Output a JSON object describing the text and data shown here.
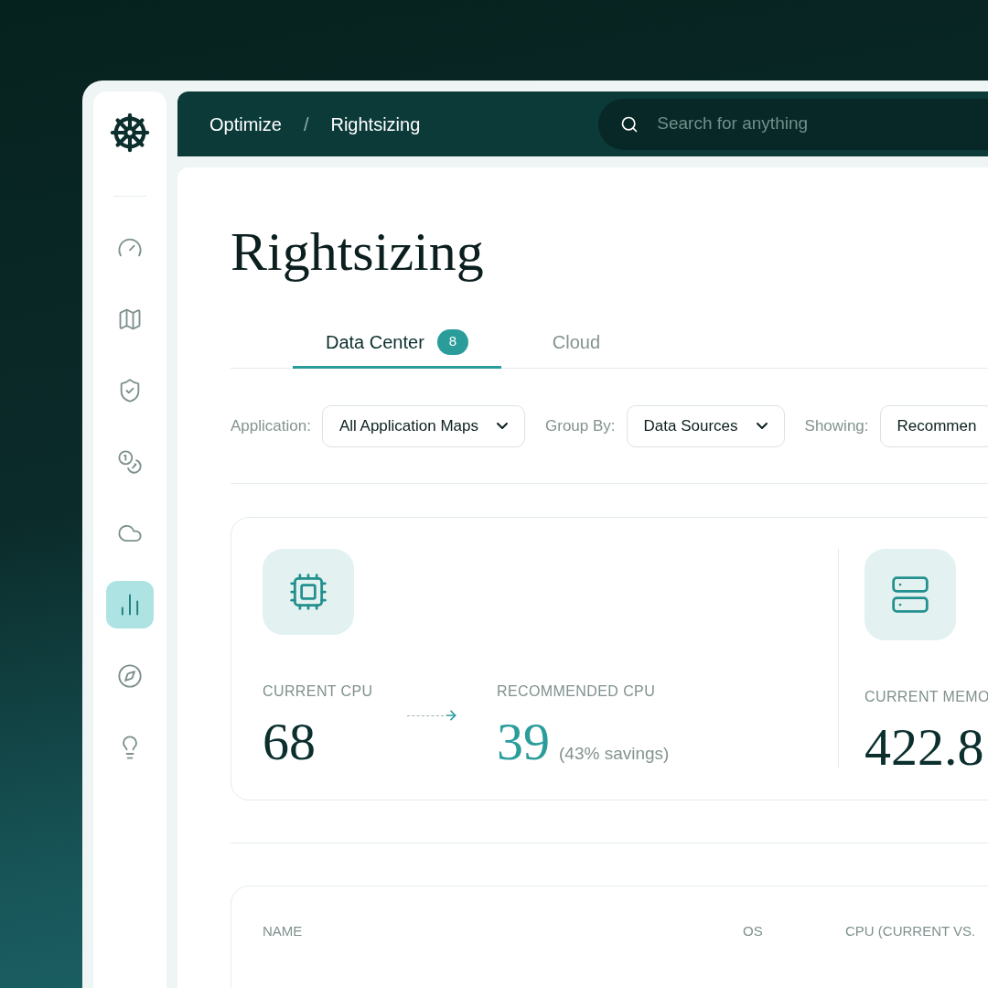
{
  "breadcrumb": [
    "Optimize",
    "Rightsizing"
  ],
  "breadcrumb_separator": "/",
  "search": {
    "placeholder": "Search for anything"
  },
  "sidebar": {
    "items": [
      {
        "selected": false
      },
      {
        "selected": false
      },
      {
        "selected": false
      },
      {
        "selected": false
      },
      {
        "selected": false
      },
      {
        "selected": true
      },
      {
        "selected": false
      },
      {
        "selected": false
      }
    ]
  },
  "page_title": "Rightsizing",
  "tabs": [
    {
      "label": "Data Center",
      "badge": "8",
      "selected": true
    },
    {
      "label": "Cloud",
      "selected": false
    }
  ],
  "filters": [
    {
      "label": "Application:",
      "value": "All Application Maps"
    },
    {
      "label": "Group By:",
      "value": "Data Sources"
    },
    {
      "label": "Showing:",
      "value": "Recommen"
    }
  ],
  "stats": [
    {
      "current_label": "CURRENT CPU",
      "current_value": "68",
      "recommended_label": "RECOMMENDED CPU",
      "recommended_value": "39",
      "savings": "(43% savings)"
    },
    {
      "current_label": "CURRENT MEMO",
      "current_value": "422.8"
    }
  ],
  "table": {
    "columns": [
      "NAME",
      "OS",
      "CPU (CURRENT VS."
    ]
  }
}
